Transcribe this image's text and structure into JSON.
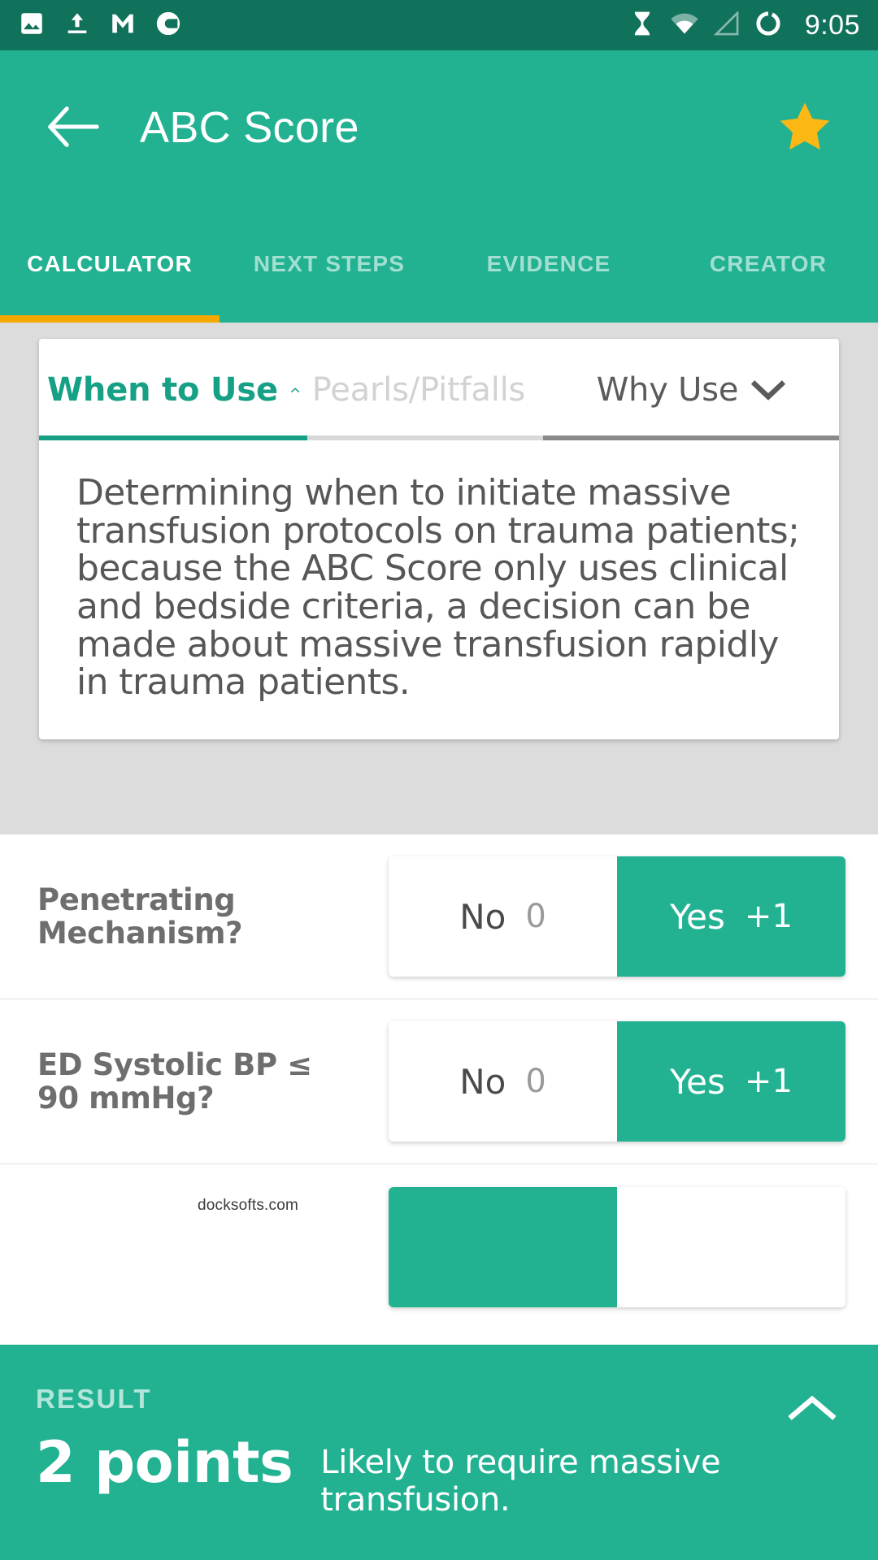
{
  "status_bar": {
    "time": "9:05",
    "left_icons": [
      "photos-icon",
      "upload-icon",
      "gmail-icon",
      "chrome-circle-icon"
    ],
    "right_icons": [
      "hourglass-icon",
      "wifi-icon",
      "cellular-signal-icon",
      "sync-circle-icon"
    ]
  },
  "app_bar": {
    "title": "ABC Score",
    "back_icon": "back-arrow-icon",
    "favorite_icon": "star-icon",
    "background_color": "#22B292",
    "status_bar_color": "#11725B"
  },
  "tabs": {
    "items": [
      {
        "label": "CALCULATOR",
        "active": true
      },
      {
        "label": "NEXT STEPS",
        "active": false
      },
      {
        "label": "EVIDENCE",
        "active": false
      },
      {
        "label": "CREATOR",
        "active": false
      }
    ],
    "indicator_color": "#F5A800"
  },
  "info_card": {
    "accordion_tabs": [
      {
        "label": "When to Use",
        "chevron": "chevron-up-icon",
        "state": "expanded"
      },
      {
        "label": "Pearls/Pitfalls",
        "chevron": "chevron-down-icon",
        "state": "collapsed"
      },
      {
        "label": "Why Use",
        "chevron": "chevron-down-icon",
        "state": "collapsed"
      }
    ],
    "body": "Determining when to initiate massive transfusion protocols on trauma patients; because the ABC Score only uses clinical and bedside criteria, a decision can be made about massive transfusion rapidly in trauma patients."
  },
  "questions": [
    {
      "label": "Penetrating Mechanism?",
      "options": [
        {
          "text": "No",
          "points": "0",
          "selected": false
        },
        {
          "text": "Yes",
          "points": "+1",
          "selected": true
        }
      ]
    },
    {
      "label": "ED Systolic BP ≤ 90 mmHg?",
      "options": [
        {
          "text": "No",
          "points": "0",
          "selected": false
        },
        {
          "text": "Yes",
          "points": "+1",
          "selected": true
        }
      ]
    },
    {
      "label": "",
      "options": [
        {
          "text": "",
          "points": "",
          "selected": true
        },
        {
          "text": "",
          "points": "",
          "selected": false
        }
      ]
    }
  ],
  "watermark": "docksofts.com",
  "result": {
    "label": "RESULT",
    "score": "2 points",
    "description": "Likely to require massive transfusion.",
    "collapse_icon": "chevron-up-icon",
    "background_color": "#22B292"
  },
  "accent_colors": {
    "teal": "#22B292",
    "dark_teal": "#11725B",
    "active_accordion": "#16A085",
    "amber": "#F5A800",
    "star": "#FBB713"
  }
}
